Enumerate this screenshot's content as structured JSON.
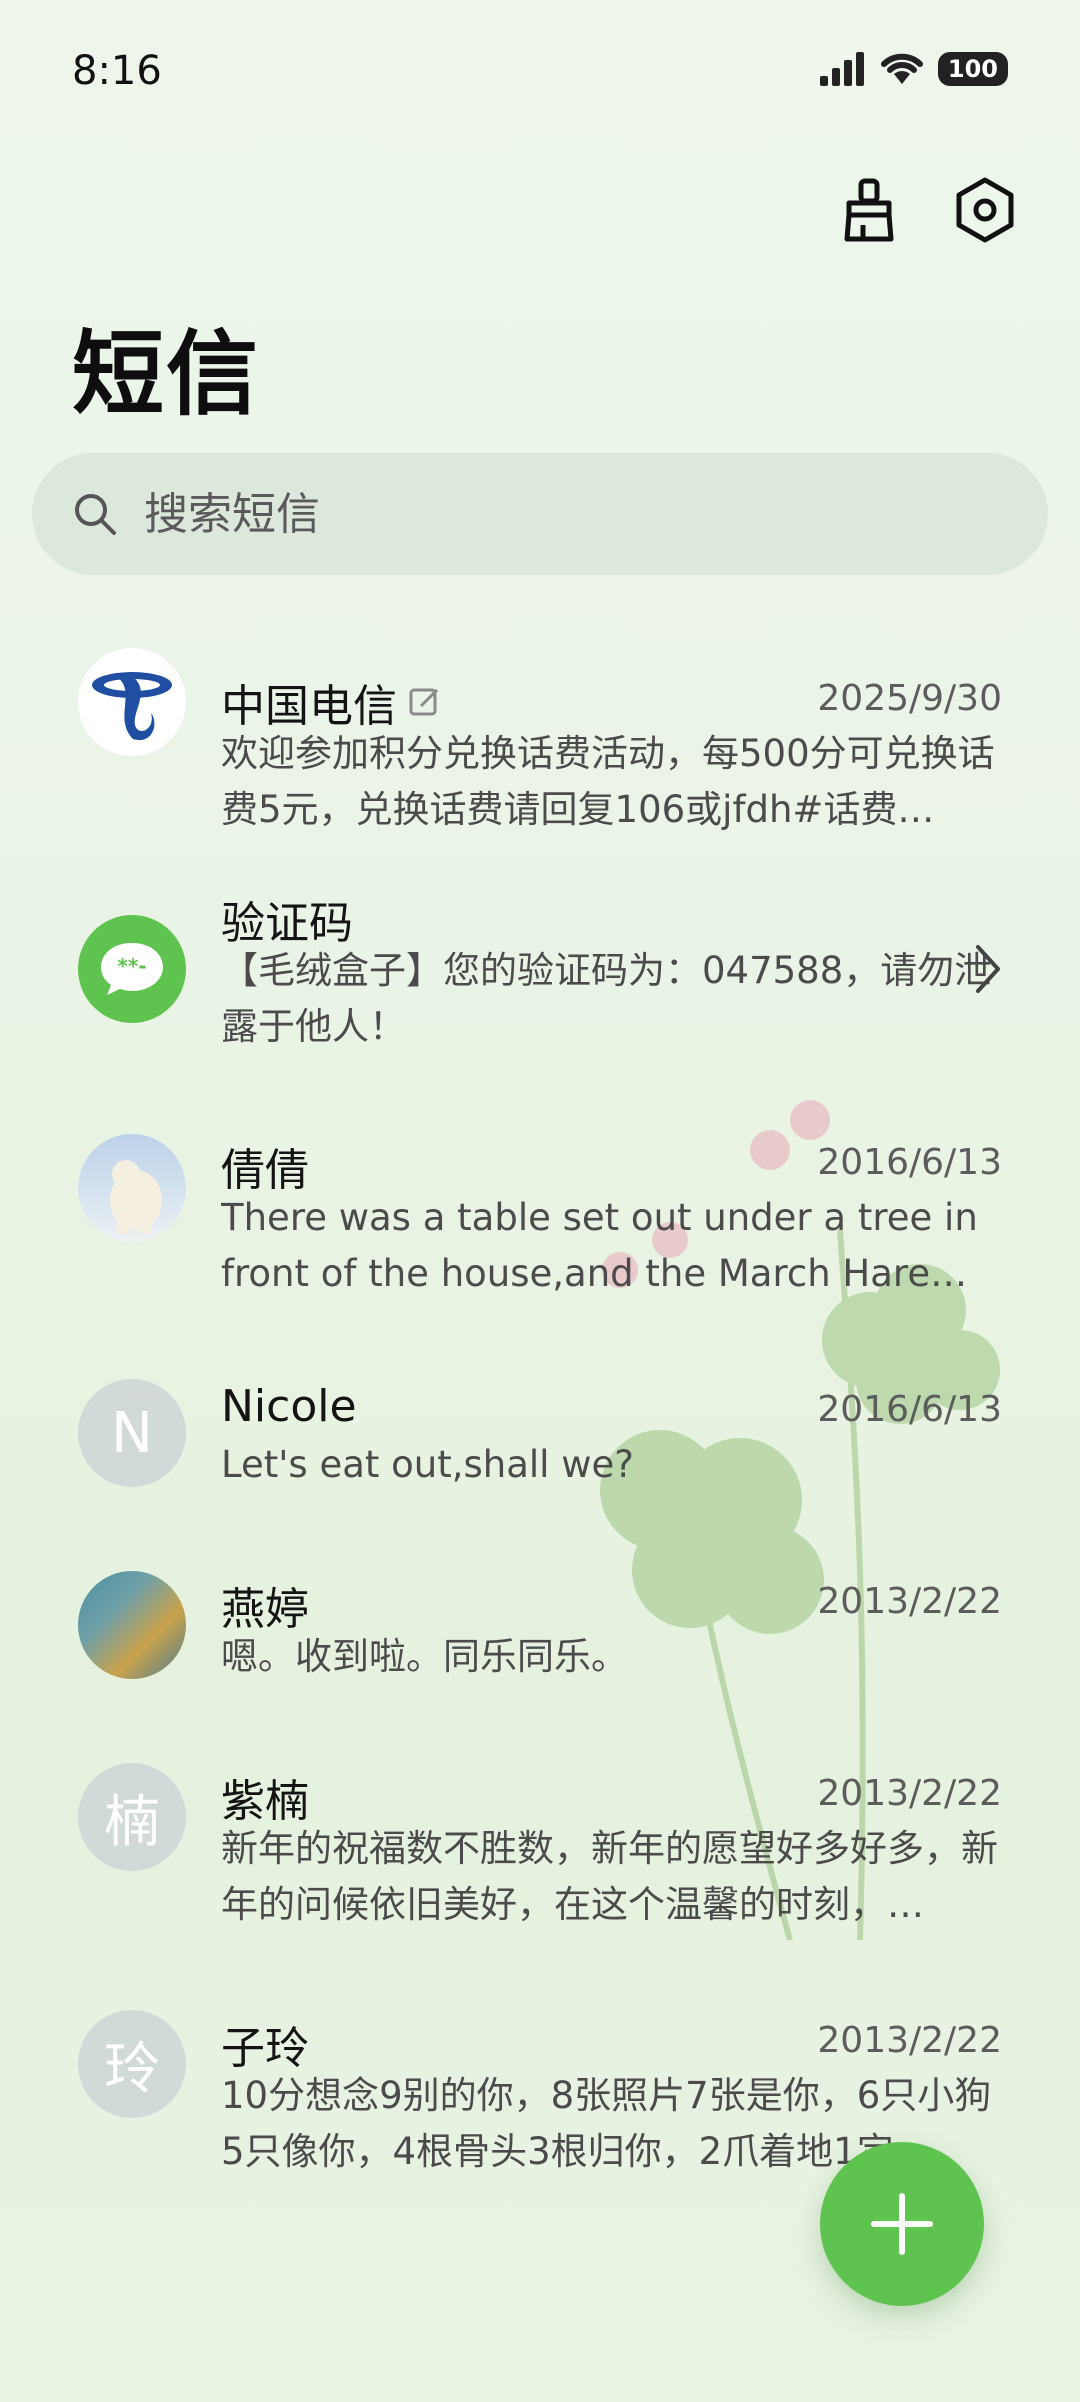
{
  "status_bar": {
    "time": "8:16",
    "battery": "100"
  },
  "header": {
    "title": "短信"
  },
  "search": {
    "placeholder": "搜索短信"
  },
  "conversations": [
    {
      "name": "中国电信",
      "date": "2025/9/30",
      "preview": "欢迎参加积分兑换话费活动，每500分可兑换话费5元，兑换话费请回复106或jfdh#话费…"
    },
    {
      "name": "验证码",
      "date": "",
      "preview": "【毛绒盒子】您的验证码为：047588，请勿泄露于他人！"
    },
    {
      "name": "倩倩",
      "date": "2016/6/13",
      "preview": "There was a table set out under a tree in front of the house,and the March Hare an…"
    },
    {
      "name": "Nicole",
      "date": "2016/6/13",
      "preview": "Let's eat out,shall we?",
      "avatar_letter": "N"
    },
    {
      "name": "燕婷",
      "date": "2013/2/22",
      "preview": "嗯。收到啦。同乐同乐。"
    },
    {
      "name": "紫楠",
      "date": "2013/2/22",
      "preview": "新年的祝福数不胜数，新年的愿望好多好多，新年的问候依旧美好，在这个温馨的时刻，…",
      "avatar_letter": "楠"
    },
    {
      "name": "子玲",
      "date": "2013/2/22",
      "preview": "10分想念9别的你，8张照片7张是你，6只小狗5只像你，4根骨头3根归你，2爪着地1定…",
      "avatar_letter": "玲"
    }
  ],
  "icons": {
    "clean": "broom-icon",
    "settings": "settings-hexagon-icon",
    "search": "search-icon",
    "compose": "plus-icon",
    "verification": "chat-bubble-icon",
    "carrier": "china-telecom-logo"
  },
  "colors": {
    "accent": "#5fc34f",
    "telecom_blue": "#1f4ea3"
  }
}
